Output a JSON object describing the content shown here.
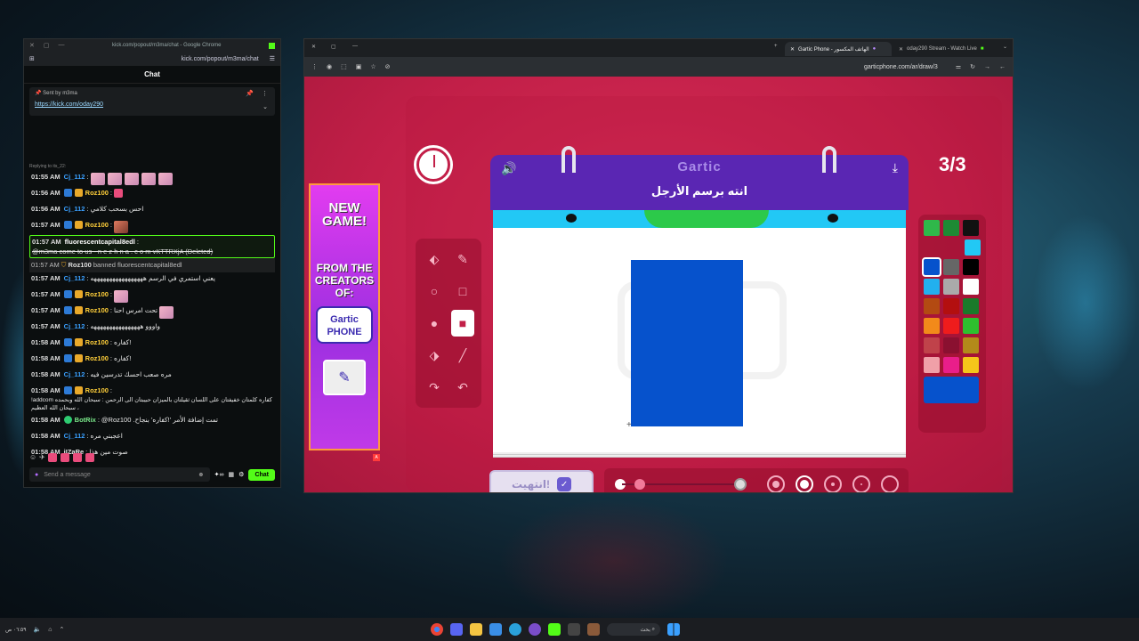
{
  "chat_window": {
    "title": "kick.com/popout/m3ma/chat - Google Chrome",
    "url": "kick.com/popout/m3ma/chat",
    "header": "Chat",
    "pinned": {
      "label": "Sent by",
      "user": "m3ma",
      "link": "https://kick.com/oday290"
    },
    "reply_note": "Replying to its_22:",
    "messages": [
      {
        "time": "01:55 AM",
        "user": "Cj_112",
        "text": ""
      },
      {
        "time": "01:56 AM",
        "user": "Roz100",
        "text": ""
      },
      {
        "time": "01:56 AM",
        "user": "Cj_112",
        "text": "احس بسحب كلامي"
      },
      {
        "time": "01:57 AM",
        "user": "Roz100",
        "text": ""
      },
      {
        "time": "01:57 AM",
        "user": "fluorescentcapital8edl",
        "text": "@m3ma come to us - n e z h n a . c o m vKTTRXjA (Deleted)"
      },
      {
        "time": "01:57 AM",
        "user": "Roz100",
        "text": "banned fluorescentcapital8edl"
      },
      {
        "time": "01:57 AM",
        "user": "Cj_112",
        "text": "يعني استمري في الرسم هههههههههههههههههه"
      },
      {
        "time": "01:57 AM",
        "user": "Roz100",
        "text": ""
      },
      {
        "time": "01:57 AM",
        "user": "Roz100",
        "text": "تحت امرس احنا"
      },
      {
        "time": "01:57 AM",
        "user": "Cj_112",
        "text": "واووو ههههههههههههههههه"
      },
      {
        "time": "01:58 AM",
        "user": "Roz100",
        "text": "كفاره!"
      },
      {
        "time": "01:58 AM",
        "user": "Roz100",
        "text": "كفاره!"
      },
      {
        "time": "01:58 AM",
        "user": "Cj_112",
        "text": "مره صعب احسك تدرسين فيه"
      },
      {
        "time": "01:58 AM",
        "user": "Roz100",
        "text": "!addcom كفاره كلمتان خفيفتان على اللسان ثقيلتان بالميزان حبيبتان الى الرحمن : سبحان الله وبحمده ، سبحان الله العظيم"
      },
      {
        "time": "01:58 AM",
        "user": "BotRix",
        "text": "@Roz100 .تمت إضافة الأمر '!كفاره' بنجاح"
      },
      {
        "time": "01:58 AM",
        "user": "Cj_112",
        "text": "اعجبني مره"
      },
      {
        "time": "01:58 AM",
        "user": "iIZaRe",
        "text": "صوت مين هذا"
      }
    ],
    "input_placeholder": "Send a message",
    "chat_button": "Chat"
  },
  "browser": {
    "tabs": [
      {
        "label": "Gartic Phone - الهاتف المكسور",
        "active": true
      },
      {
        "label": "oday290 Stream - Watch Live",
        "active": false
      }
    ],
    "url": "garticphone.com/ar/draw/3"
  },
  "ad": {
    "line1": "NEW GAME!",
    "line2": "FROM THE CREATORS OF:",
    "logo_text": "Gartic PHONE",
    "badge": "A"
  },
  "game": {
    "logo": "Gartic",
    "prompt": "انته برسم الأرجل",
    "round": "3/3",
    "done_label": "انتهيت!",
    "palette_selected": "#0652cc",
    "palette": [
      [
        "#2fb84a",
        "#1e8a34",
        "#111111"
      ],
      [
        "#22c8f5",
        "#22c8f5",
        "#22c8f5"
      ],
      [
        "#0652cc",
        "#666666",
        "#000000"
      ],
      [
        "#22b0ee",
        "#aaaaaa",
        "#ffffff"
      ],
      [
        "#b34a12",
        "#b30f0f",
        "#1a7a2a"
      ],
      [
        "#f28a1a",
        "#ef1c1c",
        "#2ec02e"
      ],
      [
        "#c0424a",
        "#8a1030",
        "#b38a1a"
      ],
      [
        "#f0a0a8",
        "#e91e8a",
        "#f5c61a"
      ]
    ]
  },
  "taskbar": {
    "search_label": "بحث",
    "clock": "٠٦:٥٩ ص"
  }
}
